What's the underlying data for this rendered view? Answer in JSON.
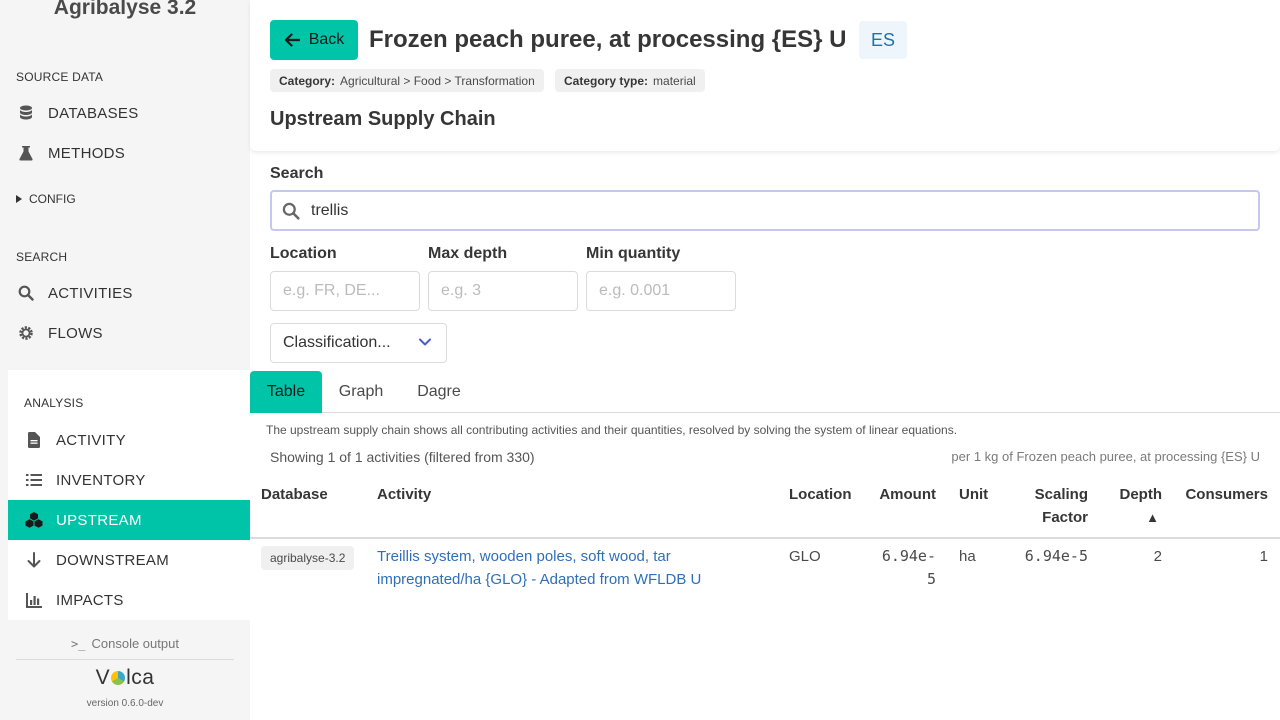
{
  "sidebar": {
    "app_title": "Agribalyse 3.2",
    "source_data_label": "SOURCE DATA",
    "databases_label": "DATABASES",
    "methods_label": "METHODS",
    "config_label": "CONFIG",
    "search_label": "SEARCH",
    "activities_label": "ACTIVITIES",
    "flows_label": "FLOWS",
    "analysis_label": "ANALYSIS",
    "activity_label": "ACTIVITY",
    "inventory_label": "INVENTORY",
    "upstream_label": "UPSTREAM",
    "downstream_label": "DOWNSTREAM",
    "impacts_label": "IMPACTS",
    "console_label": "Console output",
    "logo_pre": "V",
    "logo_post": "lca",
    "version": "version 0.6.0-dev"
  },
  "header": {
    "back_label": "Back",
    "title": "Frozen peach puree, at processing {ES} U",
    "location_tag": "ES",
    "category_key": "Category:",
    "category_value": "Agricultural > Food > Transformation",
    "category_type_key": "Category type:",
    "category_type_value": "material",
    "section_title": "Upstream Supply Chain"
  },
  "filters": {
    "search_label": "Search",
    "search_value": "trellis",
    "location_label": "Location",
    "location_placeholder": "e.g. FR, DE...",
    "max_depth_label": "Max depth",
    "max_depth_placeholder": "e.g. 3",
    "min_quantity_label": "Min quantity",
    "min_quantity_placeholder": "e.g. 0.001",
    "classification_label": "Classification..."
  },
  "tabs": [
    "Table",
    "Graph",
    "Dagre"
  ],
  "results": {
    "description": "The upstream supply chain shows all contributing activities and their quantities, resolved by solving the system of linear equations.",
    "showing": "Showing 1 of 1 activities (filtered from 330)",
    "per": "per 1 kg of Frozen peach puree, at processing {ES} U"
  },
  "table": {
    "headers": {
      "database": "Database",
      "activity": "Activity",
      "location": "Location",
      "amount": "Amount",
      "unit": "Unit",
      "scaling_1": "Scaling",
      "scaling_2": "Factor",
      "depth": "Depth",
      "depth_sort": "▲",
      "consumers": "Consumers"
    },
    "rows": [
      {
        "database": "agribalyse-3.2",
        "activity": "Treillis system, wooden poles, soft wood, tar impregnated/ha {GLO} - Adapted from WFLDB U",
        "location": "GLO",
        "amount_1": "6.94e-",
        "amount_2": "5",
        "unit": "ha",
        "scaling_factor": "6.94e-5",
        "depth": "2",
        "consumers": "1"
      }
    ]
  },
  "colors": {
    "accent": "#00c4a7",
    "link": "#2f6fb8",
    "tag_bg": "#eef6fc"
  }
}
